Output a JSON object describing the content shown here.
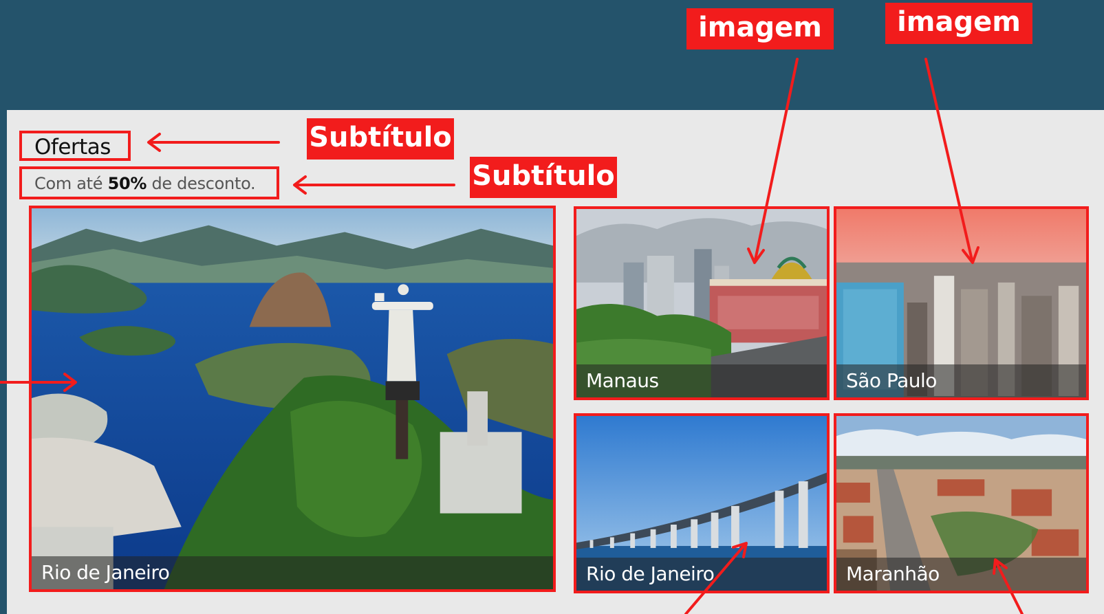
{
  "section": {
    "title": "Ofertas",
    "subtitle_prefix": "Com até ",
    "subtitle_bold": "50%",
    "subtitle_suffix": " de desconto."
  },
  "annotations": {
    "subtitle_label_1": "Subtítulo",
    "subtitle_label_2": "Subtítulo",
    "image_label_1": "imagem",
    "image_label_2": "imagem"
  },
  "tiles": [
    {
      "name": "Rio de Janeiro"
    },
    {
      "name": "Manaus"
    },
    {
      "name": "São Paulo"
    },
    {
      "name": "Rio de Janeiro"
    },
    {
      "name": "Maranhão"
    }
  ],
  "colors": {
    "header_bg": "#24536b",
    "panel_bg": "#e9e9e9",
    "annotation_red": "#f21c1c"
  }
}
